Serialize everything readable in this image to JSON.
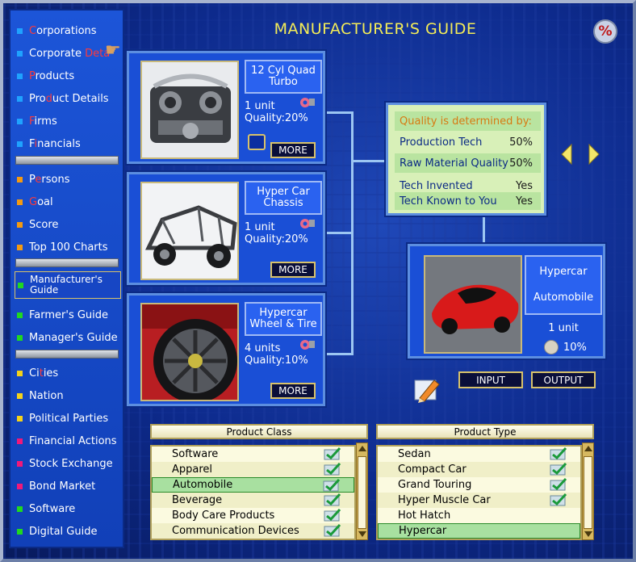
{
  "title": "MANUFACTURER'S GUIDE",
  "corner_icon": "percent-icon",
  "sidebar": {
    "items": [
      {
        "pre": "",
        "hl": "C",
        "post": "orporations",
        "color": "#1fa2ff"
      },
      {
        "pre": "Corporate ",
        "hl": "Deta",
        "post": "",
        "color": "#1fa2ff"
      },
      {
        "pre": "",
        "hl": "P",
        "post": "roducts",
        "color": "#1fa2ff"
      },
      {
        "pre": "Pro",
        "hl": "d",
        "post": "uct Details",
        "color": "#1fa2ff"
      },
      {
        "pre": "",
        "hl": "F",
        "post": "irms",
        "color": "#1fa2ff"
      },
      {
        "pre": "F",
        "hl": "i",
        "post": "nancials",
        "color": "#1fa2ff"
      },
      {
        "pre": "P",
        "hl": "e",
        "post": "rsons",
        "color": "#f39a12"
      },
      {
        "pre": "",
        "hl": "G",
        "post": "oal",
        "color": "#f39a12"
      },
      {
        "pre": "Score",
        "hl": "",
        "post": "",
        "color": "#f39a12"
      },
      {
        "pre": "Top 100 Charts",
        "hl": "",
        "post": "",
        "color": "#f39a12"
      },
      {
        "pre": "Manufacturer's Guide",
        "hl": "",
        "post": "",
        "color": "#20d820"
      },
      {
        "pre": "Farmer's Guide",
        "hl": "",
        "post": "",
        "color": "#20d820"
      },
      {
        "pre": "Manager's Guide",
        "hl": "",
        "post": "",
        "color": "#20d820"
      },
      {
        "pre": "Ci",
        "hl": "t",
        "post": "ies",
        "color": "#f3d21b"
      },
      {
        "pre": "Nation",
        "hl": "",
        "post": "",
        "color": "#f3d21b"
      },
      {
        "pre": "Political Parties",
        "hl": "",
        "post": "",
        "color": "#f3d21b"
      },
      {
        "pre": "Financial Actions",
        "hl": "",
        "post": "",
        "color": "#f0187a"
      },
      {
        "pre": "Stock Exchange",
        "hl": "",
        "post": "",
        "color": "#f0187a"
      },
      {
        "pre": "Bond Market",
        "hl": "",
        "post": "",
        "color": "#f0187a"
      },
      {
        "pre": "Software",
        "hl": "",
        "post": "",
        "color": "#20d820"
      },
      {
        "pre": "Digital Guide",
        "hl": "",
        "post": "",
        "color": "#20d820"
      }
    ]
  },
  "inputs": [
    {
      "name": "12 Cyl Quad Turbo",
      "units": "1 unit",
      "quality": "Quality:20%",
      "more": "MORE"
    },
    {
      "name": "Hyper Car Chassis",
      "units": "1 unit",
      "quality": "Quality:20%",
      "more": "MORE"
    },
    {
      "name": "Hypercar Wheel & Tire",
      "units": "4 units",
      "quality": "Quality:10%",
      "more": "MORE"
    }
  ],
  "quality_box": {
    "heading": "Quality is determined by:",
    "rows": [
      {
        "label": "Production Tech",
        "value": "50%"
      },
      {
        "label": "Raw Material Quality",
        "value": "50%"
      },
      {
        "label": "Tech Invented",
        "value": "Yes"
      },
      {
        "label": "Tech Known to You",
        "value": "Yes"
      }
    ]
  },
  "output": {
    "name": "Hypercar",
    "category": "Automobile",
    "units": "1 unit",
    "quality": "10%"
  },
  "buttons": {
    "input": "INPUT",
    "output": "OUTPUT"
  },
  "product_class": {
    "heading": "Product Class",
    "items": [
      "Software",
      "Apparel",
      "Automobile",
      "Beverage",
      "Body Care Products",
      "Communication Devices"
    ],
    "selected": 2
  },
  "product_type": {
    "heading": "Product Type",
    "items": [
      "Sedan",
      "Compact Car",
      "Grand Touring",
      "Hyper Muscle Car",
      "Hot Hatch",
      "Hypercar"
    ],
    "selected": 5
  },
  "colors": {
    "accent_yellow": "#f4ec57",
    "panel_blue": "#1a4fd6",
    "list_select": "#a8e0a0"
  }
}
